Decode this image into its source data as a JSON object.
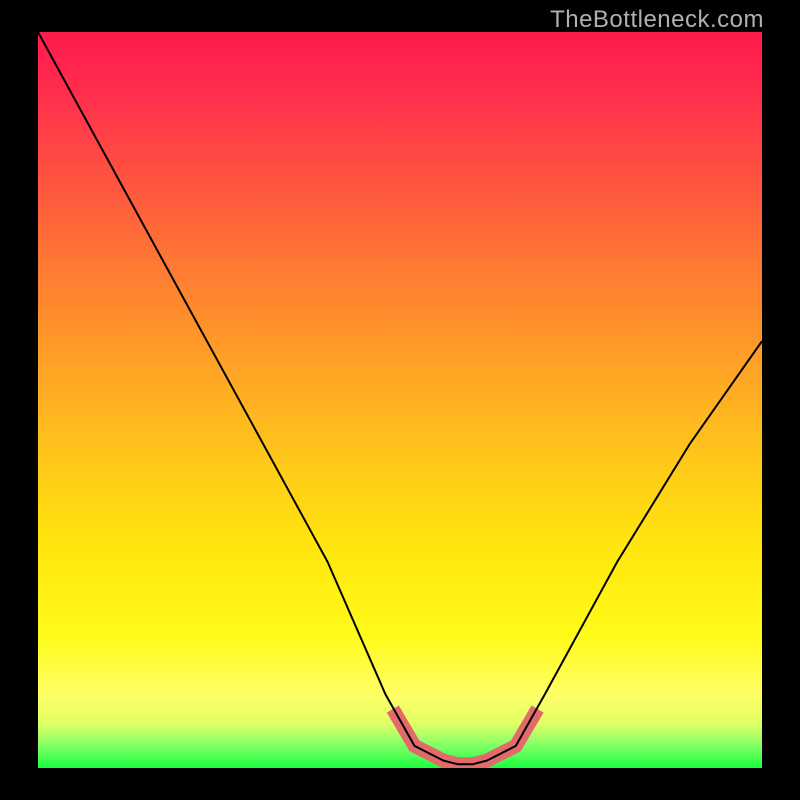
{
  "watermark": "TheBottleneck.com",
  "chart_data": {
    "type": "line",
    "title": "",
    "xlabel": "",
    "ylabel": "",
    "xlim": [
      0,
      100
    ],
    "ylim": [
      0,
      100
    ],
    "series": [
      {
        "name": "bottleneck-curve",
        "x": [
          0,
          10,
          20,
          30,
          40,
          48,
          52,
          56,
          58,
          60,
          62,
          66,
          70,
          80,
          90,
          100
        ],
        "y": [
          100,
          82,
          64,
          46,
          28,
          10,
          3,
          1,
          0.5,
          0.5,
          1,
          3,
          10,
          28,
          44,
          58
        ]
      }
    ],
    "highlight": {
      "name": "optimal-range",
      "x": [
        49,
        52,
        56,
        58,
        60,
        62,
        66,
        69
      ],
      "y": [
        8,
        3,
        1,
        0.5,
        0.5,
        1,
        3,
        8
      ]
    },
    "gradient_stops": [
      {
        "pos": 0.0,
        "color": "#ff1a4d"
      },
      {
        "pos": 0.2,
        "color": "#ff5340"
      },
      {
        "pos": 0.45,
        "color": "#ffa126"
      },
      {
        "pos": 0.7,
        "color": "#ffe60d"
      },
      {
        "pos": 0.9,
        "color": "#ffff66"
      },
      {
        "pos": 1.0,
        "color": "#1aff40"
      }
    ]
  }
}
